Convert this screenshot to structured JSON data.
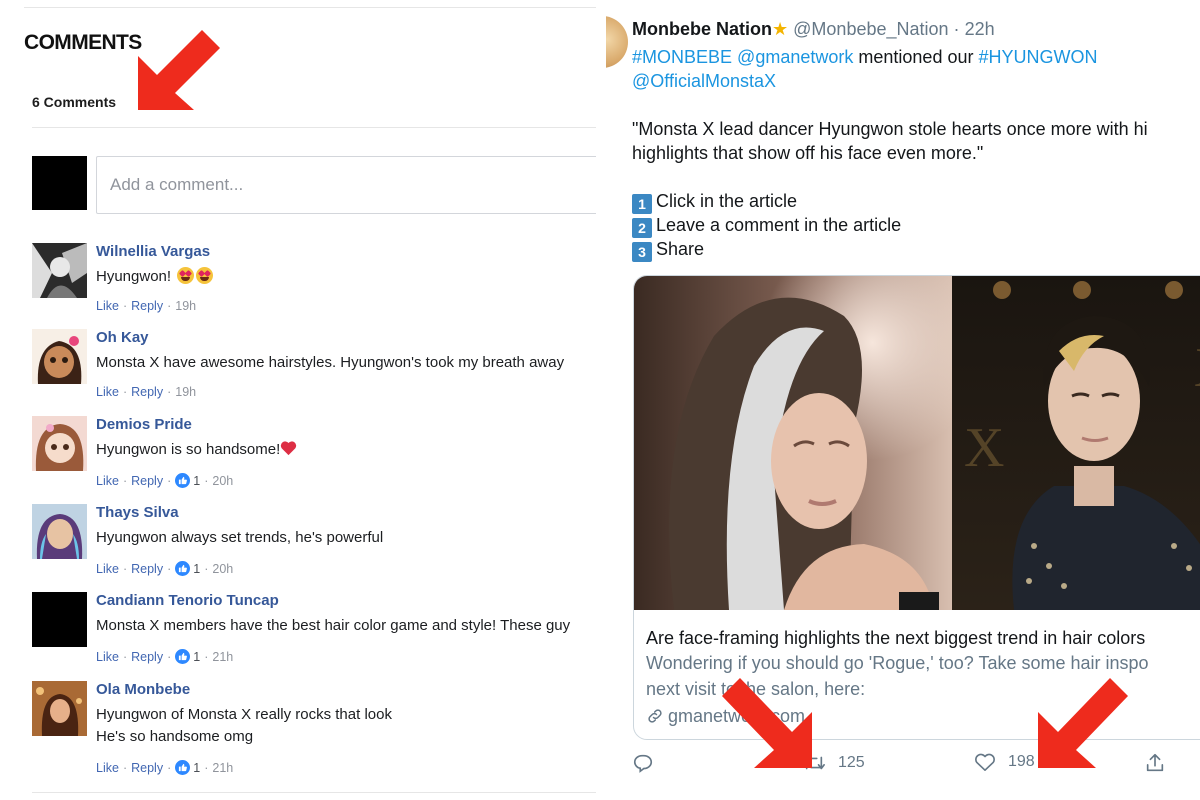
{
  "comments_panel": {
    "title": "COMMENTS",
    "count_label": "6 Comments",
    "input_placeholder": "Add a comment...",
    "like_label": "Like",
    "reply_label": "Reply",
    "comments": [
      {
        "name": "Wilnellia Vargas",
        "text": "Hyungwon!",
        "emoji": [
          "heart-eyes",
          "heart-eyes"
        ],
        "likes": "",
        "time": "19h"
      },
      {
        "name": "Oh Kay",
        "text": "Monsta X have awesome hairstyles. Hyungwon's took my breath away",
        "likes": "",
        "time": "19h"
      },
      {
        "name": "Demios Pride",
        "text": "Hyungwon is so handsome!",
        "emoji": [
          "red-heart"
        ],
        "likes": "1",
        "time": "20h"
      },
      {
        "name": "Thays Silva",
        "text": "Hyungwon always set trends, he's powerful",
        "likes": "1",
        "time": "20h"
      },
      {
        "name": "Candiann Tenorio Tuncap",
        "text": "Monsta X members have the best hair color game and style! These guy",
        "likes": "1",
        "time": "21h"
      },
      {
        "name": "Ola Monbebe",
        "text": "Hyungwon of Monsta X really rocks that look",
        "text2": "He's so handsome omg",
        "likes": "1",
        "time": "21h"
      }
    ]
  },
  "tweet": {
    "name": "Monbebe Nation",
    "handle": "@Monbebe_Nation",
    "separator": "·",
    "time": "22h",
    "line1": {
      "hashtag1": "#MONBEBE",
      "mention1": "@gmanetwork",
      "text": "mentioned our",
      "hashtag2": "#HYUNGWON"
    },
    "line2": "@OfficialMonstaX",
    "quote_line1": "\"Monsta X lead dancer Hyungwon stole hearts once more with hi",
    "quote_line2": "highlights that show off his face even more.\"",
    "steps": [
      {
        "num": "1",
        "text": "Click in the article"
      },
      {
        "num": "2",
        "text": "Leave a comment in the article"
      },
      {
        "num": "3",
        "text": "Share"
      }
    ],
    "card": {
      "title": "Are face-framing highlights the next biggest trend in hair colors",
      "desc_line1": "Wondering if you should go 'Rogue,' too? Take some hair inspo",
      "desc_line2": "next visit to the salon, here:",
      "domain": "gmanetwork.com"
    },
    "actions": {
      "retweets": "125",
      "likes": "198"
    }
  },
  "colors": {
    "link_blue": "#365899",
    "twitter_blue": "#1b95e0",
    "arrow_red": "#ee2b1d",
    "meta_grey": "#90949c"
  }
}
